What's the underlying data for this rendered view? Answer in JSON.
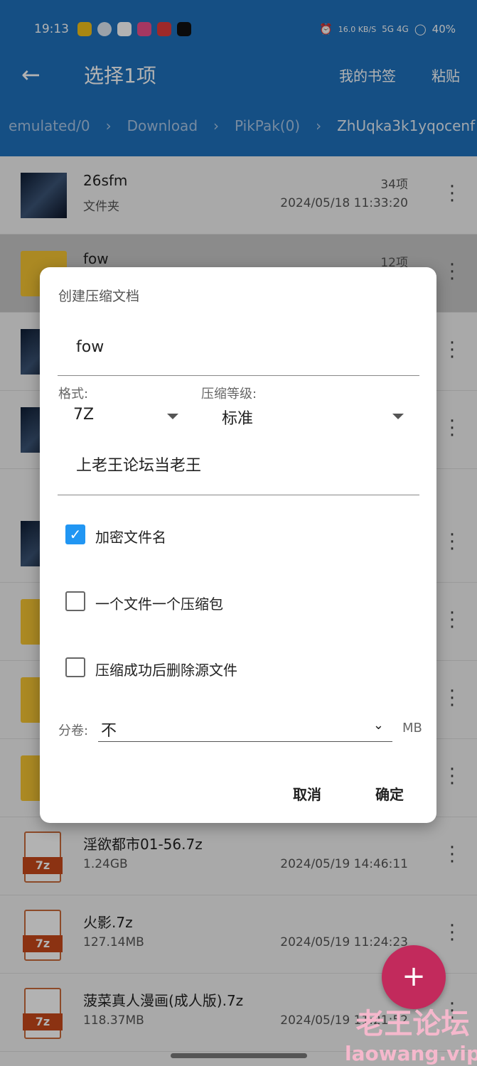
{
  "status": {
    "time": "19:13",
    "speed": "16.0 KB/S",
    "network": "5G 4G",
    "battery": "40%"
  },
  "toolbar": {
    "title": "选择1项",
    "bookmarks": "我的书签",
    "paste": "粘贴"
  },
  "breadcrumb": [
    "emulated/0",
    "Download",
    "PikPak(0)",
    "ZhUqka3k1yqocenf"
  ],
  "files": [
    {
      "name": "26sfm",
      "sub": "文件夹",
      "count": "34项",
      "date": "2024/05/18 11:33:20",
      "icon": "image"
    },
    {
      "name": "fow",
      "sub": "",
      "count": "12项",
      "date": "",
      "icon": "folder",
      "selected": true
    },
    {
      "name": "",
      "sub": "",
      "count": "",
      "date": "",
      "icon": "image"
    },
    {
      "name": "",
      "sub": "",
      "count": "",
      "date": "",
      "icon": "image"
    },
    {
      "name": "",
      "sub": "",
      "count": "",
      "date": "",
      "icon": "image"
    },
    {
      "name": "",
      "sub": "",
      "count": "",
      "date": "",
      "icon": "folder"
    },
    {
      "name": "",
      "sub": "",
      "count": "",
      "date": "",
      "icon": "folder"
    },
    {
      "name": "",
      "sub": "",
      "count": "",
      "date": "",
      "icon": "folder"
    },
    {
      "name": "淫欲都市01-56.7z",
      "sub": "1.24GB",
      "count": "",
      "date": "2024/05/19 14:46:11",
      "icon": "7z"
    },
    {
      "name": "火影.7z",
      "sub": "127.14MB",
      "count": "",
      "date": "2024/05/19 11:24:23",
      "icon": "7z"
    },
    {
      "name": "菠菜真人漫画(成人版).7z",
      "sub": "118.37MB",
      "count": "",
      "date": "2024/05/19 11:21:52",
      "icon": "7z"
    }
  ],
  "dialog": {
    "title": "创建压缩文档",
    "filename": "fow",
    "format_label": "格式:",
    "format_value": "7Z",
    "level_label": "压缩等级:",
    "level_value": "标准",
    "password": "上老王论坛当老王",
    "encrypt_names": {
      "label": "加密文件名",
      "checked": true
    },
    "one_per_file": {
      "label": "一个文件一个压缩包",
      "checked": false
    },
    "delete_source": {
      "label": "压缩成功后删除源文件",
      "checked": false
    },
    "split_label": "分卷:",
    "split_value": "不",
    "split_unit": "MB",
    "cancel": "取消",
    "ok": "确定"
  },
  "fab_icon": "plus-icon",
  "watermark": {
    "cn": "老王论坛",
    "url": "laowang.vip"
  },
  "colors": {
    "appbar": "#1f72bd",
    "fab": "#c22a5c",
    "checkbox": "#2196f3"
  }
}
